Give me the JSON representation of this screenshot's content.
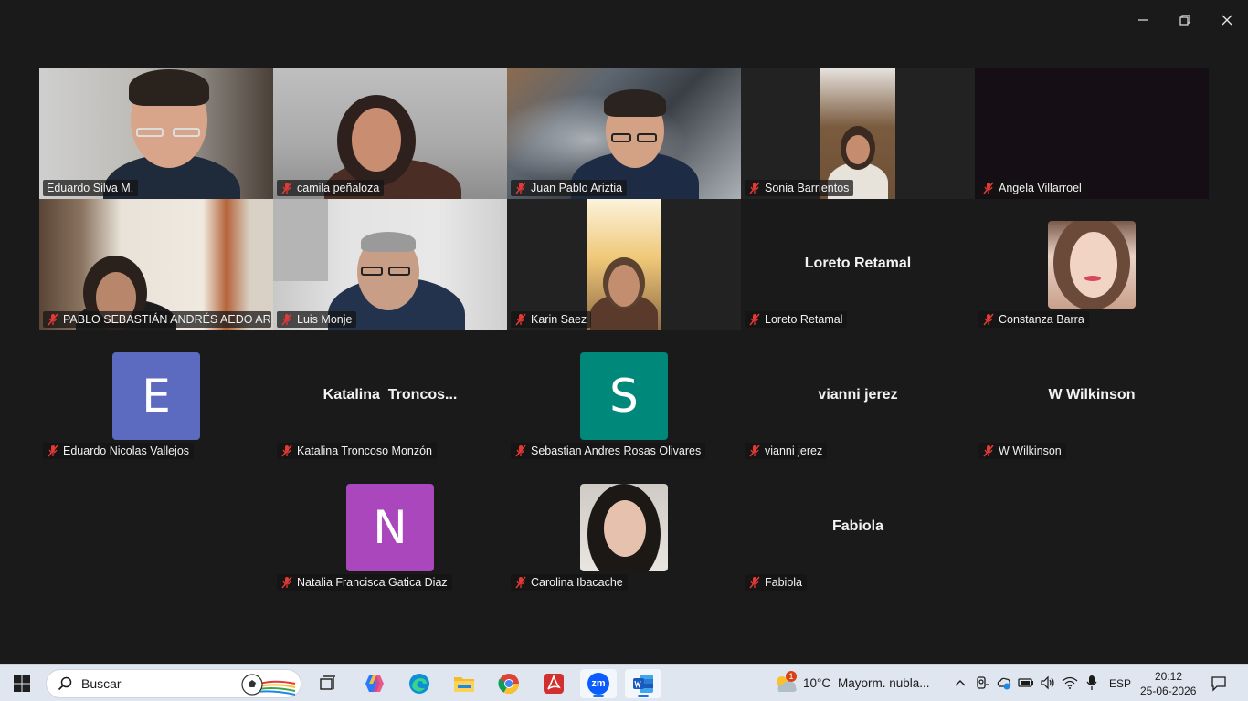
{
  "window": {
    "minimize_icon": "minimize-icon",
    "restore_icon": "restore-icon",
    "close_icon": "close-icon"
  },
  "participants": [
    {
      "name": "Eduardo Silva M.",
      "type": "video",
      "muted": false,
      "active_speaker": true
    },
    {
      "name": "camila peñaloza",
      "type": "video",
      "muted": true
    },
    {
      "name": "Juan Pablo Ariztia",
      "type": "video",
      "muted": true
    },
    {
      "name": "Sonia Barrientos",
      "type": "video",
      "muted": true
    },
    {
      "name": "Angela Villarroel",
      "type": "video",
      "muted": true
    },
    {
      "name": "PABLO SEBASTIÁN ANDRÉS AEDO AR...",
      "type": "video",
      "muted": true
    },
    {
      "name": "Luis Monje",
      "type": "video",
      "muted": true
    },
    {
      "name": "Karin Saez",
      "type": "video",
      "muted": true
    },
    {
      "name": "Loreto Retamal",
      "type": "name",
      "display": "Loreto Retamal",
      "muted": true
    },
    {
      "name": "Constanza Barra",
      "type": "photo",
      "muted": true
    },
    {
      "name": "Eduardo Nicolas Vallejos",
      "type": "letter",
      "letter": "E",
      "color": "#5c6bc0",
      "muted": true
    },
    {
      "name": "Katalina Troncoso Monzón",
      "type": "name",
      "display": "Katalina  Troncos...",
      "muted": true
    },
    {
      "name": "Sebastian Andres Rosas Olivares",
      "type": "letter",
      "letter": "S",
      "color": "#00897b",
      "muted": true
    },
    {
      "name": "vianni jerez",
      "type": "name",
      "display": "vianni jerez",
      "muted": true
    },
    {
      "name": "W Wilkinson",
      "type": "name",
      "display": "W Wilkinson",
      "muted": true
    },
    {
      "name": "Natalia Francisca Gatica Diaz",
      "type": "letter",
      "letter": "N",
      "color": "#ab47bc",
      "muted": true
    },
    {
      "name": "Carolina Ibacache",
      "type": "photo",
      "muted": true
    },
    {
      "name": "Fabiola",
      "type": "name",
      "display": "Fabiola",
      "muted": true
    }
  ],
  "taskbar": {
    "start_icon": "windows-start-icon",
    "search_placeholder": "Buscar",
    "apps": [
      "task-view",
      "copilot",
      "edge",
      "file-explorer",
      "chrome",
      "acrobat",
      "zoom",
      "word"
    ],
    "zoom_label": "zm",
    "weather": {
      "badge": "1",
      "temp": "10°C",
      "desc": "Mayorm. nubla..."
    },
    "language": "ESP",
    "time": "20:12",
    "date": "25-06-2026"
  },
  "colors": {
    "background": "#1a1a1a",
    "active_speaker": "#2fd16a",
    "mute_icon": "#e53935",
    "taskbar": "#dfe6ef"
  }
}
